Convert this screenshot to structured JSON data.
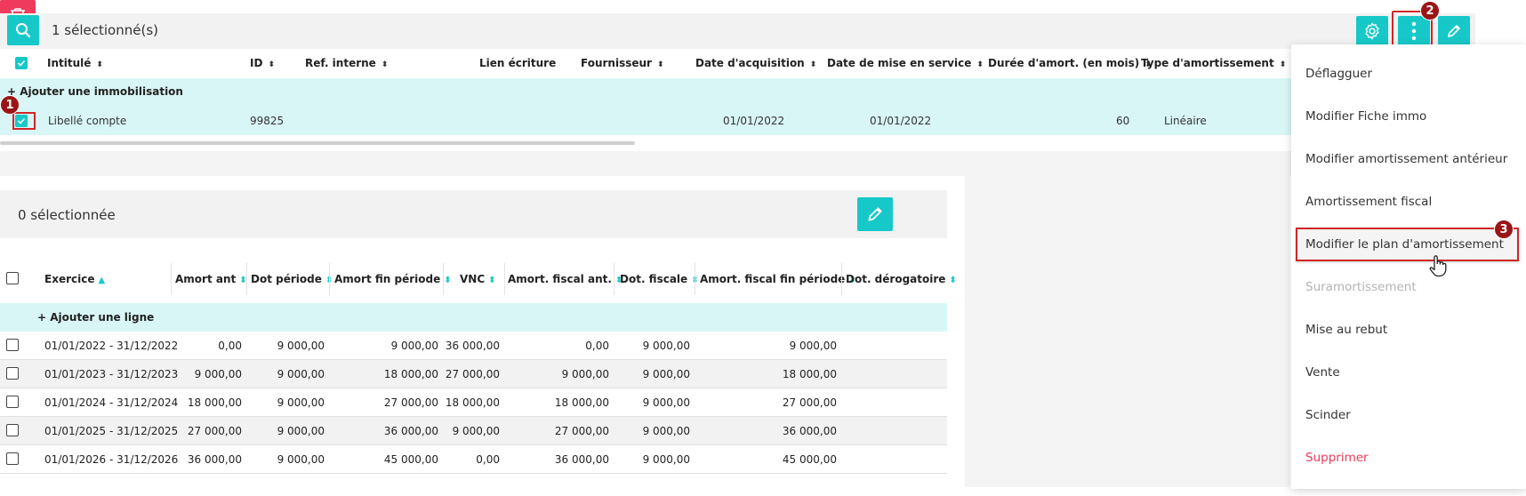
{
  "top_panel": {
    "selected_count": "1 sélectionné(s)",
    "columns": [
      {
        "label": "Intitulé",
        "sortable": true
      },
      {
        "label": "ID",
        "sortable": true
      },
      {
        "label": "Ref. interne",
        "sortable": true
      },
      {
        "label": "Lien écriture",
        "sortable": false
      },
      {
        "label": "Fournisseur",
        "sortable": true
      },
      {
        "label": "Date d'acquisition",
        "sortable": true
      },
      {
        "label": "Date de mise en service",
        "sortable": true
      },
      {
        "label": "Durée d'amort. (en mois)",
        "sortable": true
      },
      {
        "label": "Type d'amortissement",
        "sortable": true
      }
    ],
    "add_label": "+ Ajouter une immobilisation",
    "row": {
      "intitule": "Libellé compte",
      "id": "99825",
      "date_acquisition": "01/01/2022",
      "date_mise_service": "01/01/2022",
      "duree": "60",
      "type": "Linéaire",
      "selected": true
    }
  },
  "bottom_panel": {
    "selected_count": "0 sélectionnée",
    "columns": [
      "Exercice",
      "Amort ant",
      "Dot période",
      "Amort fin période",
      "VNC",
      "Amort. fiscal ant.",
      "Dot. fiscale",
      "Amort. fiscal fin période",
      "Dot. dérogatoire"
    ],
    "add_label": "Ajouter une ligne",
    "add_icon": "+",
    "rows": [
      {
        "exercice": "01/01/2022 - 31/12/2022",
        "amort_ant": "0,00",
        "dot_periode": "9 000,00",
        "amort_fin": "9 000,00",
        "vnc": "36 000,00",
        "fiscal_ant": "0,00",
        "dot_fiscale": "9 000,00",
        "fiscal_fin": "9 000,00",
        "derogatoire": ""
      },
      {
        "exercice": "01/01/2023 - 31/12/2023",
        "amort_ant": "9 000,00",
        "dot_periode": "9 000,00",
        "amort_fin": "18 000,00",
        "vnc": "27 000,00",
        "fiscal_ant": "9 000,00",
        "dot_fiscale": "9 000,00",
        "fiscal_fin": "18 000,00",
        "derogatoire": ""
      },
      {
        "exercice": "01/01/2024 - 31/12/2024",
        "amort_ant": "18 000,00",
        "dot_periode": "9 000,00",
        "amort_fin": "27 000,00",
        "vnc": "18 000,00",
        "fiscal_ant": "18 000,00",
        "dot_fiscale": "9 000,00",
        "fiscal_fin": "27 000,00",
        "derogatoire": ""
      },
      {
        "exercice": "01/01/2025 - 31/12/2025",
        "amort_ant": "27 000,00",
        "dot_periode": "9 000,00",
        "amort_fin": "36 000,00",
        "vnc": "9 000,00",
        "fiscal_ant": "27 000,00",
        "dot_fiscale": "9 000,00",
        "fiscal_fin": "36 000,00",
        "derogatoire": ""
      },
      {
        "exercice": "01/01/2026 - 31/12/2026",
        "amort_ant": "36 000,00",
        "dot_periode": "9 000,00",
        "amort_fin": "45 000,00",
        "vnc": "0,00",
        "fiscal_ant": "36 000,00",
        "dot_fiscale": "9 000,00",
        "fiscal_fin": "45 000,00",
        "derogatoire": ""
      }
    ]
  },
  "menu": {
    "items": [
      {
        "label": "Déflagguer",
        "state": "normal"
      },
      {
        "label": "Modifier Fiche immo",
        "state": "normal"
      },
      {
        "label": "Modifier amortissement antérieur",
        "state": "normal"
      },
      {
        "label": "Amortissement fiscal",
        "state": "normal"
      },
      {
        "label": "Modifier le plan d'amortissement",
        "state": "hover"
      },
      {
        "label": "Suramortissement",
        "state": "disabled"
      },
      {
        "label": "Mise au rebut",
        "state": "normal"
      },
      {
        "label": "Vente",
        "state": "normal"
      },
      {
        "label": "Scinder",
        "state": "normal"
      },
      {
        "label": "Supprimer",
        "state": "danger"
      }
    ]
  },
  "annotations": {
    "badge1": "1",
    "badge2": "2",
    "badge3": "3"
  },
  "colors": {
    "accent": "#17c8c8",
    "danger": "#ef3a5d",
    "row_highlight": "#d9f6f6",
    "annotation": "#d02525"
  },
  "icons": {
    "search": "search-icon",
    "settings": "gear-icon",
    "more": "kebab-icon",
    "edit": "pencil-icon",
    "delete": "trash-icon",
    "cursor": "hand-pointer-icon"
  }
}
